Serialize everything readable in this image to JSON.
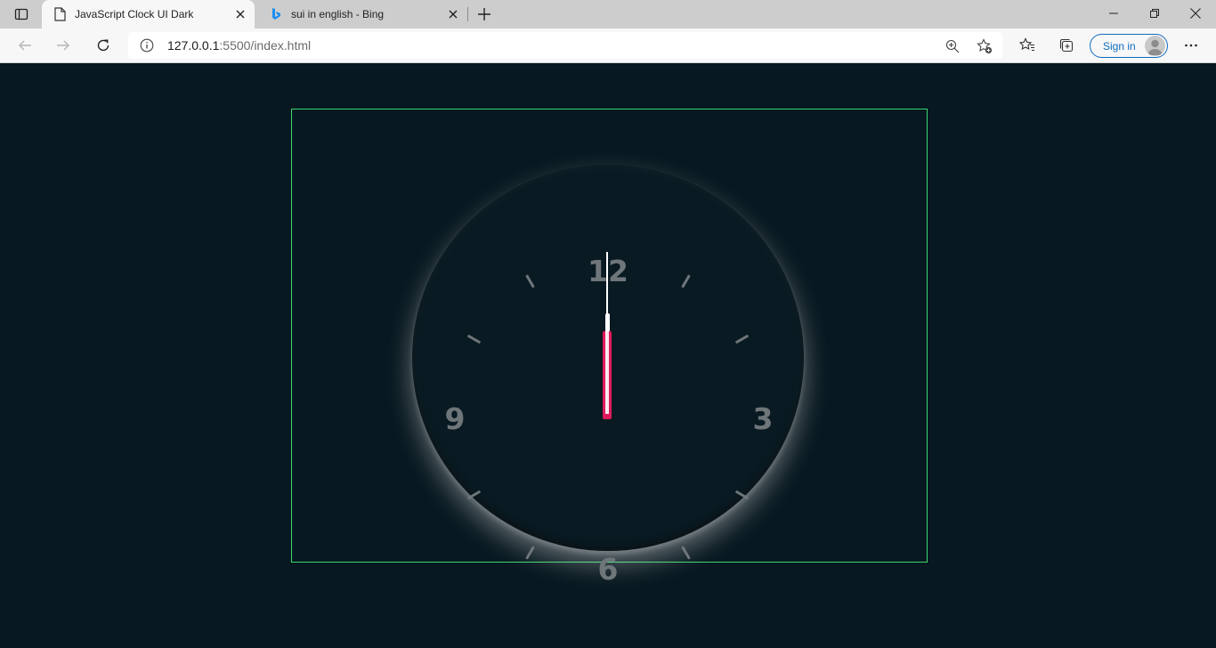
{
  "browser": {
    "tabs": [
      {
        "title": "JavaScript Clock UI Dark",
        "favicon": "page-icon",
        "active": true
      },
      {
        "title": "sui in english - Bing",
        "favicon": "bing-icon",
        "active": false
      }
    ],
    "address": {
      "url_host": "127.0.0.1",
      "url_rest": ":5500/index.html"
    },
    "signin_label": "Sign in"
  },
  "clock": {
    "numerals": {
      "twelve": "12",
      "three": "3",
      "six": "6",
      "nine": "9"
    },
    "colors": {
      "background": "#081820",
      "frame_border": "#3ad66e",
      "numerals": "#6e767a",
      "hour_hand": "#e0195a",
      "minute_hand": "#ffffff",
      "second_hand": "#ffffff"
    }
  }
}
